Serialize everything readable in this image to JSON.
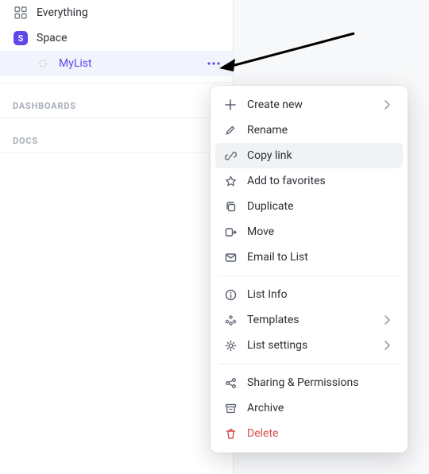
{
  "sidebar": {
    "items": [
      {
        "label": "Everything",
        "icon": "everything"
      },
      {
        "label": "Space",
        "icon": "space",
        "badge": "S"
      },
      {
        "label": "MyList",
        "icon": "list",
        "selected": true
      }
    ],
    "sections": [
      {
        "label": "DASHBOARDS"
      },
      {
        "label": "DOCS"
      }
    ]
  },
  "contextMenu": {
    "groups": [
      [
        {
          "label": "Create new",
          "icon": "plus",
          "submenu": true
        },
        {
          "label": "Rename",
          "icon": "pencil"
        },
        {
          "label": "Copy link",
          "icon": "link",
          "hovered": true
        },
        {
          "label": "Add to favorites",
          "icon": "star"
        },
        {
          "label": "Duplicate",
          "icon": "duplicate"
        },
        {
          "label": "Move",
          "icon": "move"
        },
        {
          "label": "Email to List",
          "icon": "mail"
        }
      ],
      [
        {
          "label": "List Info",
          "icon": "info"
        },
        {
          "label": "Templates",
          "icon": "templates",
          "submenu": true
        },
        {
          "label": "List settings",
          "icon": "settings",
          "submenu": true
        }
      ],
      [
        {
          "label": "Sharing & Permissions",
          "icon": "share"
        },
        {
          "label": "Archive",
          "icon": "archive"
        },
        {
          "label": "Delete",
          "icon": "trash",
          "danger": true
        }
      ]
    ]
  }
}
